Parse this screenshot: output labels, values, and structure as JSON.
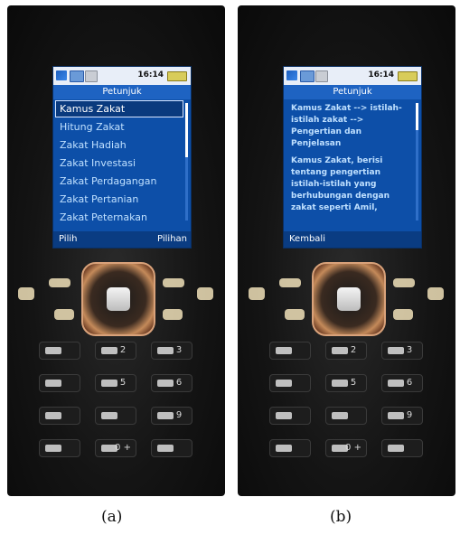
{
  "phones": [
    {
      "id": "a",
      "caption": "(a)",
      "status": {
        "time": "16:14"
      },
      "title": "Petunjuk",
      "menu_items": [
        "Kamus Zakat",
        "Hitung Zakat",
        "Zakat Hadiah",
        "Zakat Investasi",
        "Zakat Perdagangan",
        "Zakat Pertanian",
        "Zakat Peternakan"
      ],
      "selected_index": 0,
      "softkeys": {
        "left": "Pilih",
        "right": "Pilihan"
      }
    },
    {
      "id": "b",
      "caption": "(b)",
      "status": {
        "time": "16:14"
      },
      "title": "Petunjuk",
      "paragraphs": [
        "Kamus Zakat --> istilah-istilah zakat --> Pengertian dan Penjelasan",
        "Kamus Zakat, berisi tentang pengertian istilah-istilah yang berhubungan dengan zakat seperti Amil,"
      ],
      "softkeys": {
        "left": "Kembali",
        "right": ""
      }
    }
  ],
  "keypad_labels": [
    "2",
    "3",
    "5",
    "6",
    "9",
    "0 +"
  ],
  "icons": [
    "signal-icon",
    "network-icon",
    "message-icon",
    "battery-icon"
  ],
  "colors": {
    "screen_bg": "#0d4fa8",
    "menu_text": "#bfe0ff",
    "selection_bg": "#0a3a7e"
  }
}
